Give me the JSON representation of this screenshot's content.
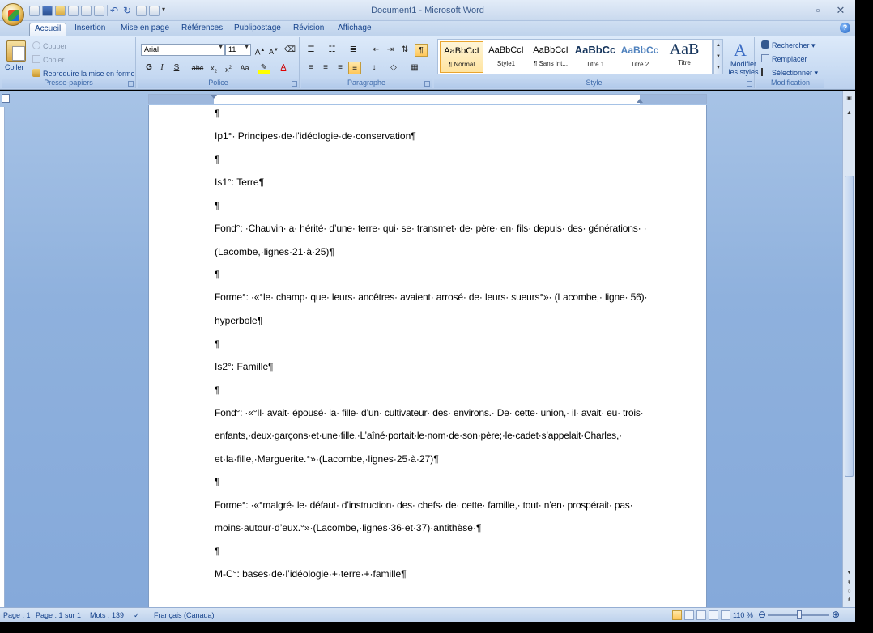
{
  "window": {
    "title": "Document1 - Microsoft Word"
  },
  "tabs": [
    "Accueil",
    "Insertion",
    "Mise en page",
    "Références",
    "Publipostage",
    "Révision",
    "Affichage"
  ],
  "clipboard": {
    "paste": "Coller",
    "cut": "Couper",
    "copy": "Copier",
    "format_painter": "Reproduire la mise en forme",
    "group": "Presse-papiers"
  },
  "font": {
    "name": "Arial",
    "size": "11",
    "group": "Police"
  },
  "paragraph": {
    "group": "Paragraphe"
  },
  "styles": {
    "items": [
      {
        "sample": "AaBbCcI",
        "name": "¶ Normal"
      },
      {
        "sample": "AaBbCcI",
        "name": "Style1"
      },
      {
        "sample": "AaBbCcI",
        "name": "¶ Sans int..."
      },
      {
        "sample": "AaBbCc",
        "name": "Titre 1"
      },
      {
        "sample": "AaBbCc",
        "name": "Titre 2"
      },
      {
        "sample": "AaB",
        "name": "Titre"
      }
    ],
    "modify": "Modifier les styles",
    "group": "Style"
  },
  "editing": {
    "find": "Rechercher",
    "replace": "Remplacer",
    "select": "Sélectionner",
    "group": "Modification"
  },
  "document": {
    "paragraphs": [
      "¶",
      "Ip1°· Principes·de·l’idéologie·de·conservation¶",
      "¶",
      "Is1°: Terre¶",
      "¶",
      "Fond°: ·Chauvin· a· hérité· d’une· terre· qui· se· transmet· de· père· en· fils· depuis· des· générations· ·",
      "(Lacombe,·lignes·21·à·25)¶",
      "¶",
      "Forme°: ·«°le· champ· que· leurs· ancêtres· avaient· arrosé· de· leurs· sueurs°»· (Lacombe,· ligne· 56)·",
      "hyperbole¶",
      "¶",
      "Is2°: Famille¶",
      "¶",
      "Fond°: ·«°Il· avait· épousé· la· fille· d’un· cultivateur· des· environs.· De· cette· union,· il· avait· eu· trois·",
      "enfants,·deux·garçons·et·une·fille.·L’aîné·portait·le·nom·de·son·père;·le·cadet·s’appelait·Charles,·",
      "et·la·fille,·Marguerite.°»·(Lacombe,·lignes·25·à·27)¶",
      "¶",
      "Forme°: ·«°malgré· le· défaut· d’instruction· des· chefs· de· cette· famille,· tout· n’en· prospérait· pas·",
      "moins·autour·d’eux.°»·(Lacombe,·lignes·36·et·37)·antithèse·¶",
      "¶",
      "M-C°: bases·de·l’idéologie·+·terre·+·famille¶"
    ]
  },
  "status": {
    "page": "Page : 1",
    "pages": "Page : 1 sur 1",
    "words": "Mots : 139",
    "language": "Français (Canada)",
    "zoom": "110 %"
  }
}
